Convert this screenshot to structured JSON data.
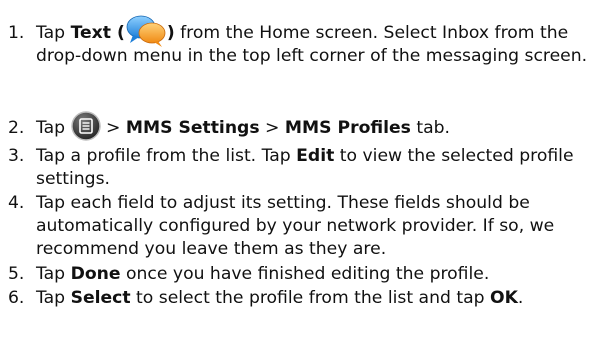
{
  "steps": [
    {
      "number": "1.",
      "parts": [
        {
          "type": "text",
          "value": "Tap "
        },
        {
          "type": "bold",
          "value": "Text ("
        },
        {
          "type": "icon",
          "name": "text-messaging-icon"
        },
        {
          "type": "bold",
          "value": ")"
        },
        {
          "type": "text",
          "value": " from the Home screen. Select Inbox from the drop-down menu in the top left corner of the messaging screen."
        }
      ]
    },
    {
      "number": "2.",
      "parts": [
        {
          "type": "text",
          "value": "Tap "
        },
        {
          "type": "icon",
          "name": "menu-icon"
        },
        {
          "type": "text",
          "value": " > "
        },
        {
          "type": "bold",
          "value": "MMS Settings"
        },
        {
          "type": "text",
          "value": " > "
        },
        {
          "type": "bold",
          "value": "MMS Profiles"
        },
        {
          "type": "text",
          "value": " tab."
        }
      ]
    },
    {
      "number": "3.",
      "parts": [
        {
          "type": "text",
          "value": "Tap a profile from the list. Tap "
        },
        {
          "type": "bold",
          "value": "Edit"
        },
        {
          "type": "text",
          "value": " to view the selected profile settings."
        }
      ]
    },
    {
      "number": "4.",
      "parts": [
        {
          "type": "text",
          "value": "Tap each field to adjust its setting. These fields should be automatically configured by your network provider. If so, we recommend you leave them as they are."
        }
      ]
    },
    {
      "number": "5.",
      "parts": [
        {
          "type": "text",
          "value": "Tap "
        },
        {
          "type": "bold",
          "value": "Done"
        },
        {
          "type": "text",
          "value": " once you have finished editing the profile."
        }
      ]
    },
    {
      "number": "6.",
      "parts": [
        {
          "type": "text",
          "value": "Tap "
        },
        {
          "type": "bold",
          "value": "Select"
        },
        {
          "type": "text",
          "value": " to select the profile from the list and tap "
        },
        {
          "type": "bold",
          "value": "OK"
        },
        {
          "type": "text",
          "value": "."
        }
      ]
    }
  ]
}
